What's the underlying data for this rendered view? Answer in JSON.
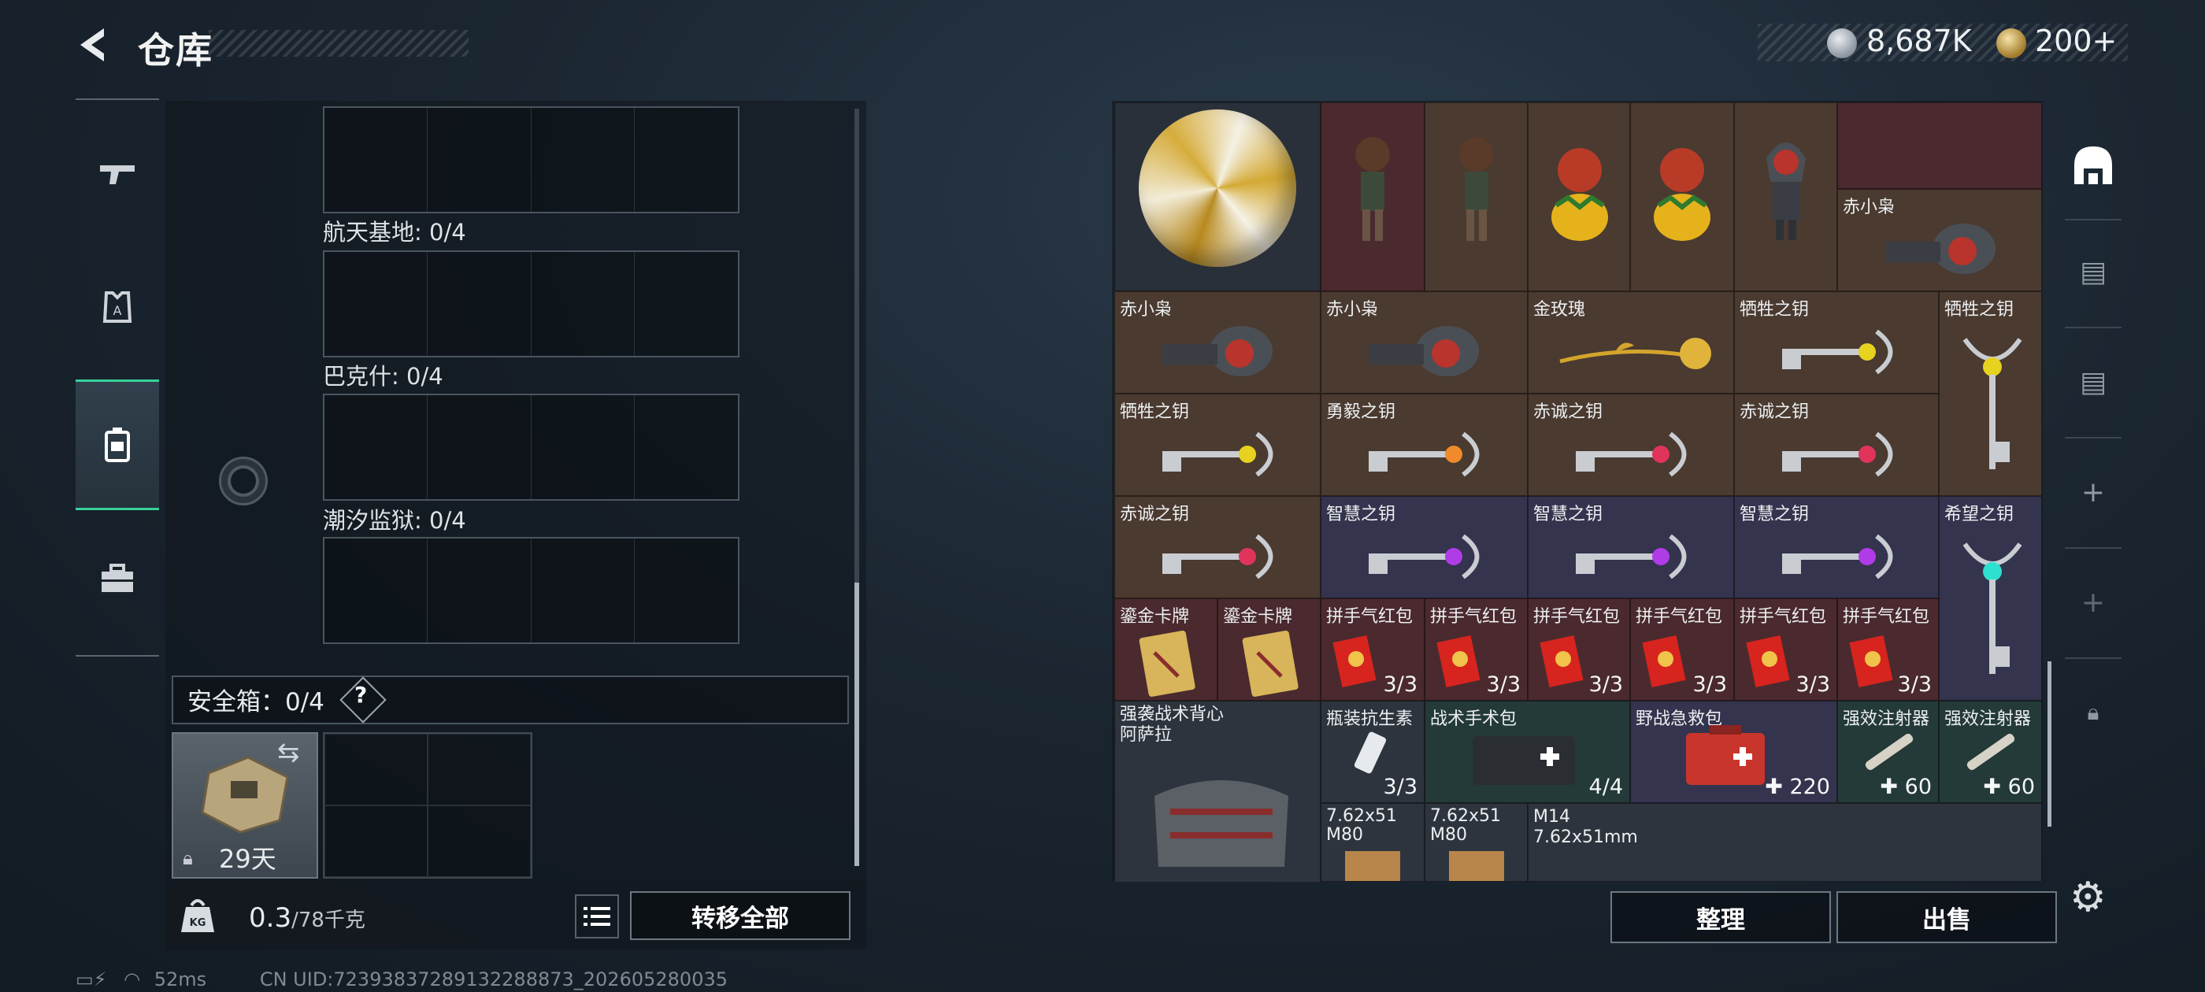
{
  "header": {
    "title": "仓库",
    "currency_silver": "8,687K",
    "currency_gold": "200+"
  },
  "left": {
    "categories": [
      {
        "label": "航天基地: 0/4"
      },
      {
        "label": "巴克什: 0/4"
      },
      {
        "label": "潮汐监狱: 0/4"
      }
    ],
    "safe_box_label": "安全箱：0/4",
    "help": "?",
    "case_days": "29天",
    "weight_value": "0.3",
    "weight_max": "/78千克",
    "transfer_all": "转移全部"
  },
  "status": {
    "ping": "52ms",
    "uid": "CN UID:72393837289132288873_202605280035"
  },
  "stash": {
    "items": [
      {
        "name": "赤小枭"
      },
      {
        "name": "赤小枭"
      },
      {
        "name": "赤小枭"
      },
      {
        "name": "金玫瑰"
      },
      {
        "name": "牺牲之钥"
      },
      {
        "name": "牺牲之钥"
      },
      {
        "name": "牺牲之钥"
      },
      {
        "name": "勇毅之钥"
      },
      {
        "name": "赤诚之钥"
      },
      {
        "name": "赤诚之钥"
      },
      {
        "name": "赤诚之钥"
      },
      {
        "name": "智慧之钥"
      },
      {
        "name": "智慧之钥"
      },
      {
        "name": "智慧之钥"
      },
      {
        "name": "希望之钥"
      },
      {
        "name": "鎏金卡牌"
      },
      {
        "name": "鎏金卡牌"
      },
      {
        "name": "拼手气红包",
        "count": "3/3"
      },
      {
        "name": "拼手气红包",
        "count": "3/3"
      },
      {
        "name": "拼手气红包",
        "count": "3/3"
      },
      {
        "name": "拼手气红包",
        "count": "3/3"
      },
      {
        "name": "拼手气红包",
        "count": "3/3"
      },
      {
        "name": "拼手气红包",
        "count": "3/3"
      },
      {
        "name": "强袭战术背心\n阿萨拉"
      },
      {
        "name": "瓶装抗生素",
        "count": "3/3"
      },
      {
        "name": "战术手术包",
        "count": "4/4"
      },
      {
        "name": "野战急救包",
        "count": "220"
      },
      {
        "name": "强效注射器",
        "count": "60"
      },
      {
        "name": "强效注射器",
        "count": "60"
      },
      {
        "name": "7.62x51\nM80"
      },
      {
        "name": "7.62x51\nM80"
      },
      {
        "name": "M14\n7.62x51mm"
      }
    ],
    "sort": "整理",
    "sell": "出售"
  },
  "colors": {
    "accent_green": "#37d29a",
    "rarity_red": "#4a2a2e",
    "rarity_purple": "#34344e",
    "rarity_green": "#243a38"
  }
}
